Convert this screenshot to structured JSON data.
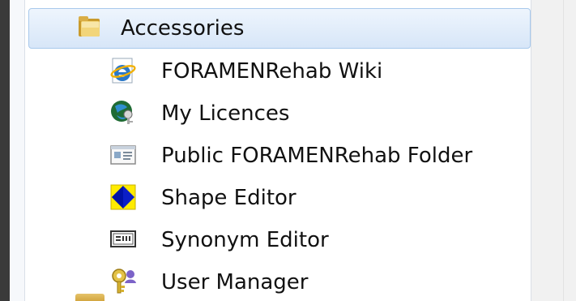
{
  "menu": {
    "group": {
      "label": "Accessories",
      "icon": "folder-icon"
    },
    "items": [
      {
        "label": "FORAMENRehab Wiki",
        "icon": "internet-explorer-icon"
      },
      {
        "label": "My Licences",
        "icon": "globe-key-icon"
      },
      {
        "label": "Public FORAMENRehab Folder",
        "icon": "window-folder-icon"
      },
      {
        "label": "Shape Editor",
        "icon": "shape-diamond-icon"
      },
      {
        "label": "Synonym Editor",
        "icon": "syn-box-icon"
      },
      {
        "label": "User Manager",
        "icon": "key-user-icon"
      }
    ],
    "colors": {
      "selection_border": "#a8c9ec",
      "selection_fill_top": "#eef5fd",
      "selection_fill_bottom": "#d7e6f8",
      "text": "#111111"
    }
  }
}
